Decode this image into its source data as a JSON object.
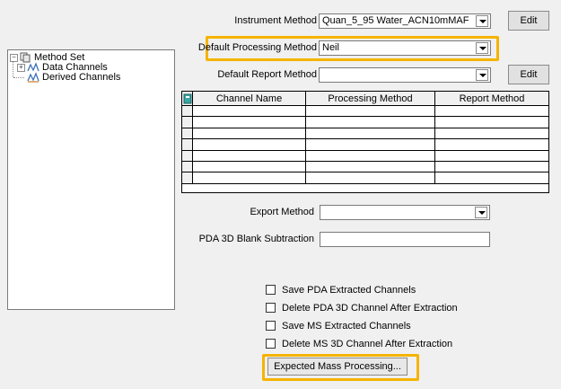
{
  "tree": {
    "root": "Method Set",
    "children": [
      "Data Channels",
      "Derived Channels"
    ]
  },
  "form": {
    "instrument_method": {
      "label": "Instrument Method",
      "value": "Quan_5_95 Water_ACN10mMAF",
      "edit": "Edit"
    },
    "default_processing_method": {
      "label": "Default Processing Method",
      "value": "Neil"
    },
    "default_report_method": {
      "label": "Default Report Method",
      "value": "",
      "edit": "Edit"
    },
    "export_method": {
      "label": "Export Method",
      "value": ""
    },
    "pda_blank": {
      "label": "PDA 3D Blank Subtraction",
      "value": ""
    }
  },
  "grid": {
    "columns": [
      "Channel Name",
      "Processing Method",
      "Report Method"
    ],
    "row_count": 7
  },
  "options": [
    {
      "label": "Save PDA Extracted Channels",
      "checked": false
    },
    {
      "label": "Delete PDA 3D Channel After Extraction",
      "checked": false
    },
    {
      "label": "Save MS Extracted Channels",
      "checked": false
    },
    {
      "label": "Delete MS 3D Channel After Extraction",
      "checked": false
    }
  ],
  "expected_mass_button": "Expected Mass Processing...",
  "colors": {
    "highlight": "#f5b400",
    "background": "#f0f0f0"
  }
}
